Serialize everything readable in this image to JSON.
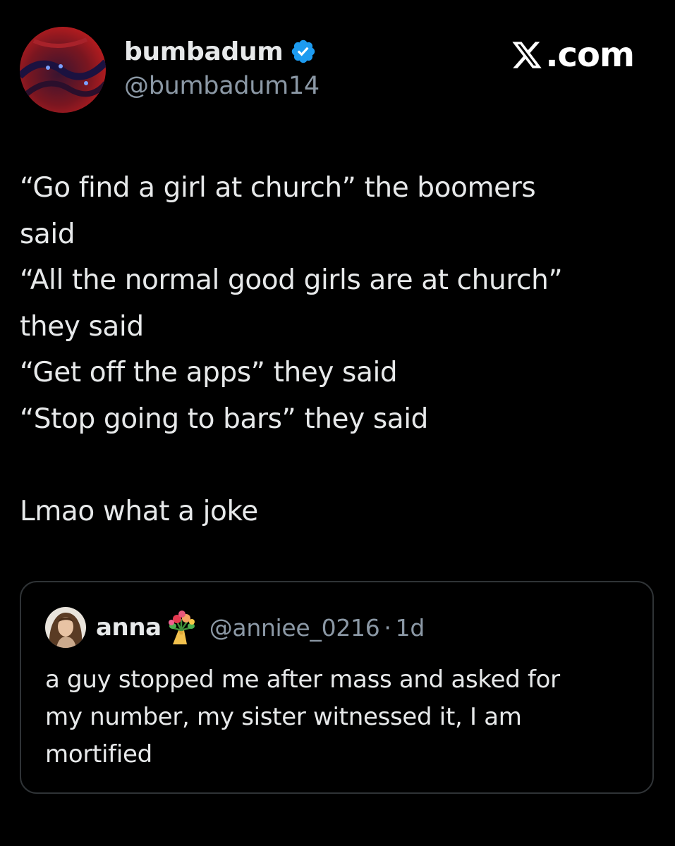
{
  "post": {
    "author": {
      "display_name": "bumbadum",
      "handle": "@bumbadum14",
      "verified": true,
      "verified_color": "#1d9bf0"
    },
    "site_brand": {
      "logo": "x-logo-icon",
      "suffix": ".com"
    },
    "text_lines": [
      "“Go find a girl at church” the boomers",
      "said",
      "“All the normal good girls are at church”",
      "they said",
      "“Get off the apps” they said",
      "“Stop going to bars” they said",
      "",
      "Lmao what a joke"
    ]
  },
  "quote": {
    "author": {
      "display_name": "anna",
      "emoji": "bouquet-icon",
      "handle": "@anniee_0216",
      "separator": "·",
      "time": "1d"
    },
    "text_lines": [
      "a guy stopped me after mass and asked for",
      "my number, my sister witnessed it, I am",
      "mortified"
    ]
  },
  "colors": {
    "background": "#000000",
    "text_primary": "#e7e9ea",
    "text_secondary": "#8b98a5",
    "border": "#2f3336"
  }
}
